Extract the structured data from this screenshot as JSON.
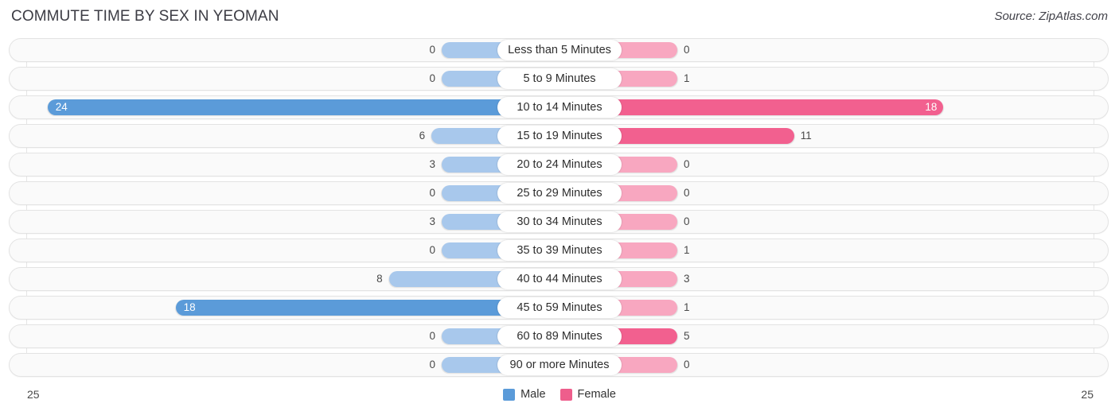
{
  "header": {
    "title": "COMMUTE TIME BY SEX IN YEOMAN",
    "source": "Source: ZipAtlas.com"
  },
  "axis": {
    "left_label": "25",
    "right_label": "25"
  },
  "legend": {
    "items": [
      {
        "label": "Male",
        "color": "#5B9BD9"
      },
      {
        "label": "Female",
        "color": "#EE5E8C"
      }
    ]
  },
  "colors": {
    "male_strong": "#5B9BD9",
    "male_light": "#A8C8EC",
    "female_strong": "#F2608F",
    "female_light": "#F8A7C0",
    "track": "#fafafa",
    "track_border": "#e3e3e3"
  },
  "chart_data": {
    "type": "bar",
    "title": "COMMUTE TIME BY SEX IN YEOMAN",
    "subtitle": "Source: ZipAtlas.com",
    "orientation": "horizontal-diverging",
    "xlabel": "",
    "ylabel": "",
    "xlim": [
      25,
      25
    ],
    "axis_max": 25,
    "grid": false,
    "legend_position": "bottom-center",
    "categories": [
      "Less than 5 Minutes",
      "5 to 9 Minutes",
      "10 to 14 Minutes",
      "15 to 19 Minutes",
      "20 to 24 Minutes",
      "25 to 29 Minutes",
      "30 to 34 Minutes",
      "35 to 39 Minutes",
      "40 to 44 Minutes",
      "45 to 59 Minutes",
      "60 to 89 Minutes",
      "90 or more Minutes"
    ],
    "series": [
      {
        "name": "Male",
        "values": [
          0,
          0,
          24,
          6,
          3,
          0,
          3,
          0,
          8,
          18,
          0,
          0
        ]
      },
      {
        "name": "Female",
        "values": [
          0,
          1,
          18,
          11,
          0,
          0,
          0,
          1,
          3,
          1,
          5,
          0
        ]
      }
    ]
  }
}
